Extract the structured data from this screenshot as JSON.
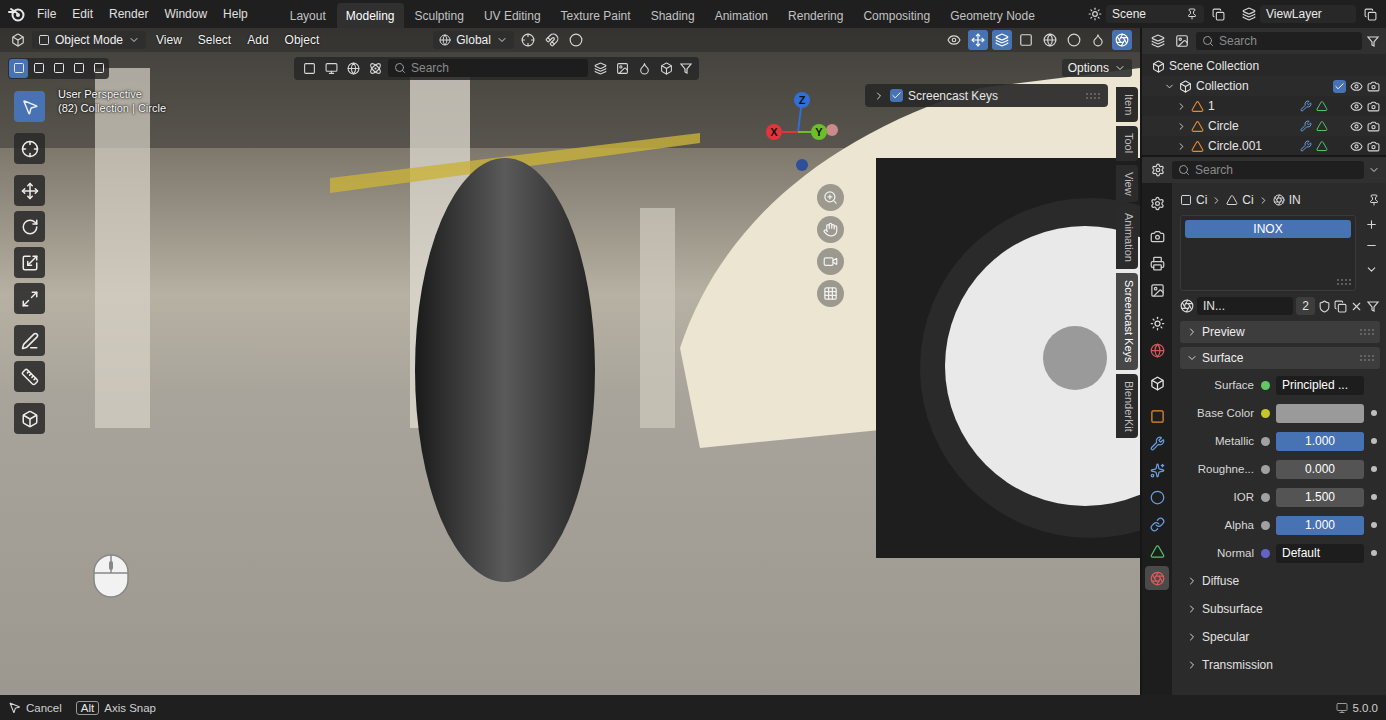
{
  "top_bar": {
    "menus": [
      "File",
      "Edit",
      "Render",
      "Window",
      "Help"
    ],
    "workspaces": [
      {
        "label": "Layout",
        "selected": false
      },
      {
        "label": "Modeling",
        "selected": true
      },
      {
        "label": "Sculpting",
        "selected": false
      },
      {
        "label": "UV Editing",
        "selected": false
      },
      {
        "label": "Texture Paint",
        "selected": false
      },
      {
        "label": "Shading",
        "selected": false
      },
      {
        "label": "Animation",
        "selected": false
      },
      {
        "label": "Rendering",
        "selected": false
      },
      {
        "label": "Compositing",
        "selected": false
      },
      {
        "label": "Geometry Node",
        "selected": false
      }
    ],
    "scene": "Scene",
    "view_layer": "ViewLayer"
  },
  "viewport": {
    "mode": "Object Mode",
    "editor_menus": [
      "View",
      "Select",
      "Add",
      "Object"
    ],
    "orientation": "Global",
    "select_modes": [
      {
        "selected": true
      },
      {
        "selected": false
      },
      {
        "selected": false
      },
      {
        "selected": false
      },
      {
        "selected": false
      }
    ],
    "search": {
      "placeholder": "Search"
    },
    "options": "Options",
    "info": [
      "User Perspective",
      "(82) Collection | Circle"
    ],
    "screencast_panel": {
      "label": "Screencast Keys",
      "checked": true,
      "expanded": false
    },
    "gizmo": [
      {
        "label": "Z",
        "color": "#2f6fd8"
      },
      {
        "label": "X",
        "color": "#e2343b"
      },
      {
        "label": "Y",
        "color": "#6cbf2a"
      }
    ],
    "tools": [
      {
        "selected": true
      },
      {
        "selected": false
      },
      {
        "selected": false
      },
      {
        "selected": false
      },
      {
        "selected": false
      },
      {
        "selected": false
      },
      {
        "selected": false
      },
      {
        "selected": false
      },
      {
        "selected": false
      }
    ],
    "side_tabs": [
      {
        "label": "Item",
        "selected": false
      },
      {
        "label": "Tool",
        "selected": false
      },
      {
        "label": "View",
        "selected": false
      },
      {
        "label": "Animation",
        "selected": false
      },
      {
        "label": "Screencast Keys",
        "selected": true
      },
      {
        "label": "BlenderKit",
        "selected": false
      }
    ]
  },
  "outliner": {
    "search": {
      "placeholder": "Search"
    },
    "items": [
      {
        "label": "Scene Collection",
        "depth": 0,
        "kind": "scene",
        "expanded": true
      },
      {
        "label": "Collection",
        "depth": 1,
        "kind": "collection",
        "expanded": true,
        "checked": true
      },
      {
        "label": "1",
        "depth": 2,
        "kind": "object",
        "expanded": false
      },
      {
        "label": "Circle",
        "depth": 2,
        "kind": "object",
        "expanded": false
      },
      {
        "label": "Circle.001",
        "depth": 2,
        "kind": "object",
        "expanded": false
      }
    ]
  },
  "properties": {
    "search": {
      "placeholder": "Search"
    },
    "tabs": [
      {
        "selected": false
      },
      {
        "selected": false
      },
      {
        "selected": false
      },
      {
        "selected": false
      },
      {
        "selected": false
      },
      {
        "selected": false
      },
      {
        "selected": false
      },
      {
        "selected": false
      },
      {
        "selected": false
      },
      {
        "selected": false
      },
      {
        "selected": false
      },
      {
        "selected": false
      },
      {
        "selected": false
      },
      {
        "selected": true
      }
    ],
    "breadcrumb": [
      "Ci",
      "Ci",
      "IN"
    ],
    "material_slots": [
      {
        "label": "INOX",
        "selected": true
      }
    ],
    "material": {
      "name": "IN...",
      "users": "2"
    },
    "panels": [
      {
        "label": "Preview",
        "expanded": false
      },
      {
        "label": "Surface",
        "expanded": true
      }
    ],
    "surface": {
      "label": "Surface",
      "shader": "Principled ...",
      "color": "#63c763"
    },
    "inputs": [
      {
        "label": "Base Color",
        "kind": "color",
        "color": "#9a9a9a",
        "socket": "#c7c729"
      },
      {
        "label": "Metallic",
        "kind": "slider",
        "level": 1,
        "reading": "1.000",
        "socket": "#a1a1a1"
      },
      {
        "label": "Roughne...",
        "kind": "slider",
        "level": 0,
        "reading": "0.000",
        "socket": "#a1a1a1"
      },
      {
        "label": "IOR",
        "kind": "slider",
        "level": 0,
        "reading": "1.500",
        "socket": "#a1a1a1"
      },
      {
        "label": "Alpha",
        "kind": "slider",
        "level": 1,
        "reading": "1.000",
        "socket": "#a1a1a1"
      },
      {
        "label": "Normal",
        "kind": "link",
        "reading": "Default",
        "socket": "#6363c7"
      }
    ],
    "subpanels": [
      {
        "label": "Diffuse",
        "expanded": false
      },
      {
        "label": "Subsurface",
        "expanded": false
      },
      {
        "label": "Specular",
        "expanded": false
      },
      {
        "label": "Transmission",
        "expanded": false
      }
    ]
  },
  "status_bar": {
    "hints": [
      {
        "kind": "mouse",
        "label": "Cancel"
      },
      {
        "kind": "key",
        "key": "Alt",
        "label": "Axis Snap"
      }
    ],
    "version": "5.0.0"
  }
}
